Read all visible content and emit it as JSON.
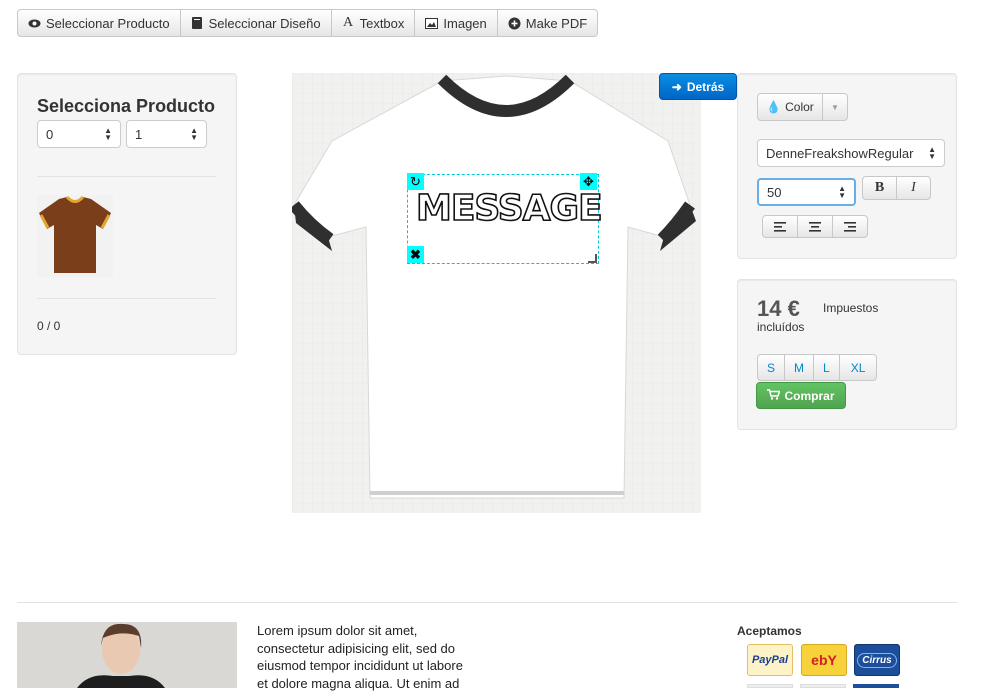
{
  "toolbar": {
    "items": [
      {
        "label": "Seleccionar Producto",
        "icon": "eye-icon"
      },
      {
        "label": "Seleccionar Diseño",
        "icon": "book-icon"
      },
      {
        "label": "Textbox",
        "icon": "text-icon"
      },
      {
        "label": "Imagen",
        "icon": "picture-icon"
      },
      {
        "label": "Make PDF",
        "icon": "plus-circle-icon"
      }
    ]
  },
  "left_panel": {
    "title": "Selecciona Producto",
    "select_a": "0",
    "select_b": "1",
    "pager": "0 / 0",
    "thumb_color": "#7a3e1a"
  },
  "canvas": {
    "toggle_label": "Detrás",
    "text_object": "MESSAGE"
  },
  "text_controls": {
    "color_label": "Color",
    "font": "DenneFreakshowRegular",
    "size": "50",
    "bold_label": "B",
    "italic_label": "I"
  },
  "price_panel": {
    "price": "14 €",
    "tax_line1": "Impuestos",
    "tax_line2": "incluídos",
    "sizes": [
      "S",
      "M",
      "L",
      "XL"
    ],
    "buy_label": "Comprar"
  },
  "footer": {
    "paragraph": "Lorem ipsum dolor sit amet, consectetur adipisicing elit, sed do eiusmod tempor incididunt ut labore et dolore magna aliqua. Ut enim ad",
    "accept_title": "Aceptamos",
    "payments": [
      "PayPal",
      "ebY",
      "Cirrus"
    ]
  },
  "colors": {
    "accent_blue": "#0072d0",
    "accent_green": "#51a351",
    "selection_cyan": "#00ffff"
  }
}
